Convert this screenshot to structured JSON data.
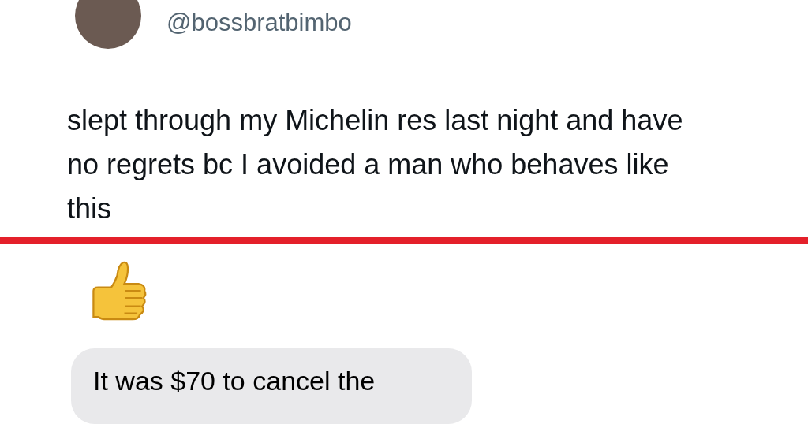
{
  "tweet": {
    "handle": "@bossbratbimbo",
    "text": "slept through my Michelin res last night and have no regrets bc I avoided a man who behaves like this"
  },
  "message": {
    "text": "It was $70 to cancel the"
  }
}
